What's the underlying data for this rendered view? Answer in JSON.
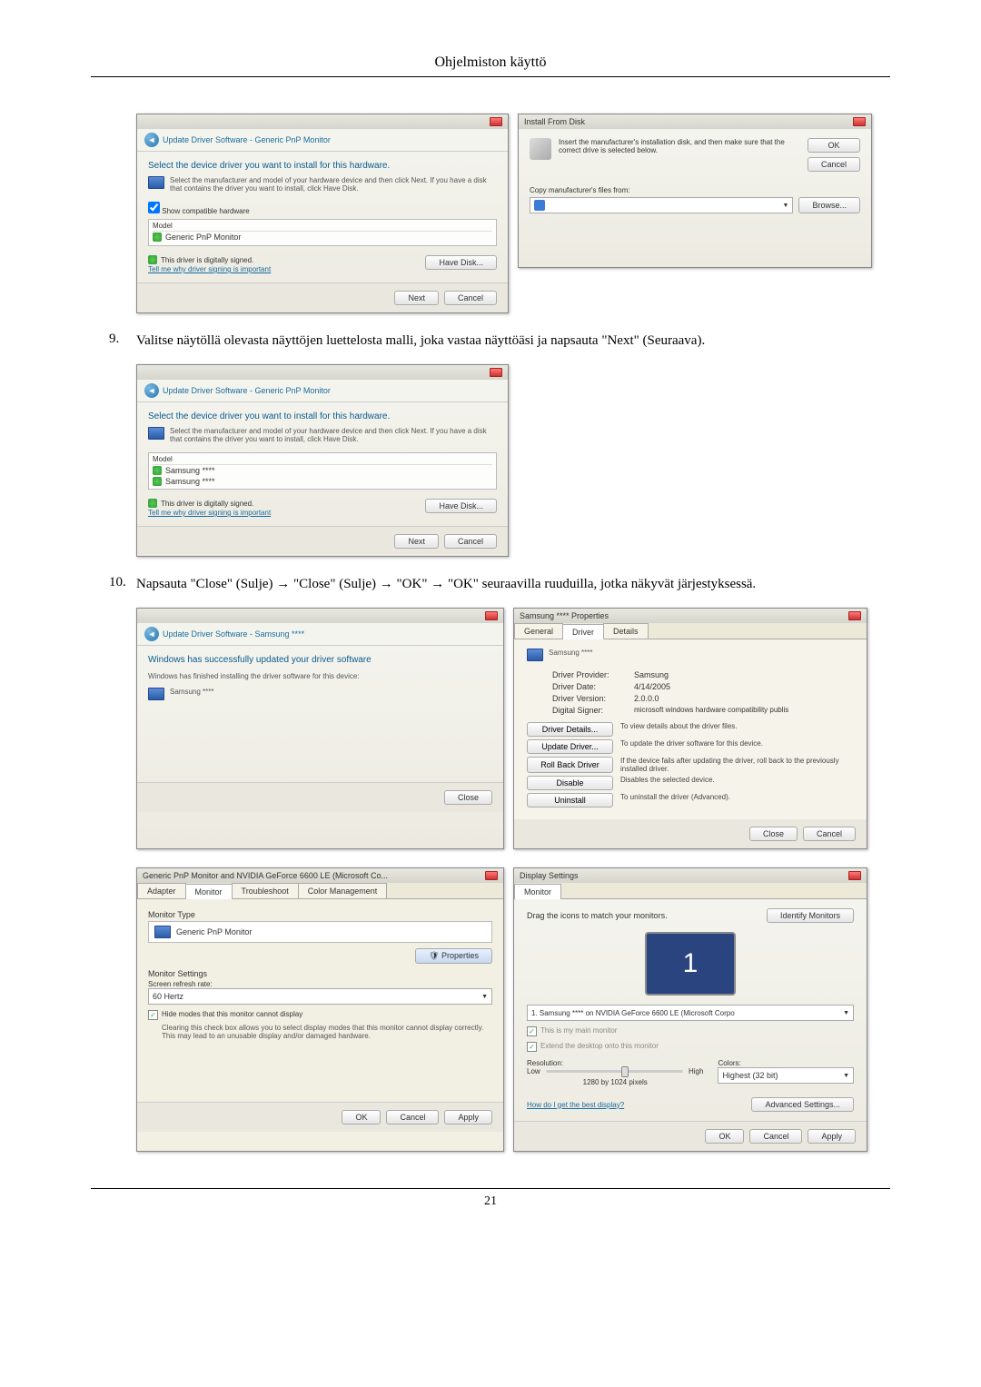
{
  "page": {
    "header": "Ohjelmiston käyttö",
    "number": "21"
  },
  "steps": {
    "s9": {
      "num": "9.",
      "text": "Valitse näytöllä olevasta näyttöjen luettelosta malli, joka vastaa näyttöäsi ja napsauta \"Next\" (Seuraava)."
    },
    "s10": {
      "num": "10.",
      "text": "Napsauta \"Close\" (Sulje) → \"Close\" (Sulje) → \"OK\" → \"OK\" seuraavilla ruuduilla, jotka näkyvät järjestyksessä."
    }
  },
  "dlg_update1": {
    "breadcrumb": "Update Driver Software - Generic PnP Monitor",
    "heading": "Select the device driver you want to install for this hardware.",
    "info": "Select the manufacturer and model of your hardware device and then click Next. If you have a disk that contains the driver you want to install, click Have Disk.",
    "show_compatible": "Show compatible hardware",
    "model_hdr": "Model",
    "model_item": "Generic PnP Monitor",
    "signed": "This driver is digitally signed.",
    "tell_me": "Tell me why driver signing is important",
    "have_disk": "Have Disk...",
    "next": "Next",
    "cancel": "Cancel"
  },
  "dlg_install_disk": {
    "title": "Install From Disk",
    "info": "Insert the manufacturer's installation disk, and then make sure that the correct drive is selected below.",
    "ok": "OK",
    "cancel": "Cancel",
    "copy_from": "Copy manufacturer's files from:",
    "browse": "Browse..."
  },
  "dlg_update2": {
    "breadcrumb": "Update Driver Software - Generic PnP Monitor",
    "heading": "Select the device driver you want to install for this hardware.",
    "info": "Select the manufacturer and model of your hardware device and then click Next. If you have a disk that contains the driver you want to install, click Have Disk.",
    "model_hdr": "Model",
    "model1": "Samsung ****",
    "model2": "Samsung ****",
    "signed": "This driver is digitally signed.",
    "tell_me": "Tell me why driver signing is important",
    "have_disk": "Have Disk...",
    "next": "Next",
    "cancel": "Cancel"
  },
  "dlg_update3": {
    "breadcrumb": "Update Driver Software - Samsung ****",
    "heading": "Windows has successfully updated your driver software",
    "info": "Windows has finished installing the driver software for this device:",
    "device": "Samsung ****",
    "close": "Close"
  },
  "dlg_props": {
    "title": "Samsung **** Properties",
    "tabs": {
      "general": "General",
      "driver": "Driver",
      "details": "Details"
    },
    "device": "Samsung ****",
    "provider_lbl": "Driver Provider:",
    "provider": "Samsung",
    "date_lbl": "Driver Date:",
    "date": "4/14/2005",
    "version_lbl": "Driver Version:",
    "version": "2.0.0.0",
    "signer_lbl": "Digital Signer:",
    "signer": "microsoft windows hardware compatibility publis",
    "btn_details": "Driver Details...",
    "desc_details": "To view details about the driver files.",
    "btn_update": "Update Driver...",
    "desc_update": "To update the driver software for this device.",
    "btn_rollback": "Roll Back Driver",
    "desc_rollback": "If the device fails after updating the driver, roll back to the previously installed driver.",
    "btn_disable": "Disable",
    "desc_disable": "Disables the selected device.",
    "btn_uninstall": "Uninstall",
    "desc_uninstall": "To uninstall the driver (Advanced).",
    "close": "Close",
    "cancel": "Cancel"
  },
  "dlg_monset": {
    "title": "Generic PnP Monitor and NVIDIA GeForce 6600 LE (Microsoft Co...",
    "tabs": {
      "adapter": "Adapter",
      "monitor": "Monitor",
      "troubleshoot": "Troubleshoot",
      "color": "Color Management"
    },
    "type_lbl": "Monitor Type",
    "type_val": "Generic PnP Monitor",
    "properties": "Properties",
    "settings_lbl": "Monitor Settings",
    "refresh_lbl": "Screen refresh rate:",
    "refresh_val": "60 Hertz",
    "hide_check": "Hide modes that this monitor cannot display",
    "hide_note": "Clearing this check box allows you to select display modes that this monitor cannot display correctly. This may lead to an unusable display and/or damaged hardware.",
    "ok": "OK",
    "cancel": "Cancel",
    "apply": "Apply"
  },
  "dlg_display": {
    "title": "Display Settings",
    "tab": "Monitor",
    "drag": "Drag the icons to match your monitors.",
    "identify": "Identify Monitors",
    "mon_num": "1",
    "monitor_list": "1. Samsung **** on NVIDIA GeForce 6600 LE (Microsoft Corpo",
    "main": "This is my main monitor",
    "extend": "Extend the desktop onto this monitor",
    "res_lbl": "Resolution:",
    "low": "Low",
    "high": "High",
    "res_val": "1280 by 1024 pixels",
    "colors_lbl": "Colors:",
    "colors_val": "Highest (32 bit)",
    "best": "How do I get the best display?",
    "advanced": "Advanced Settings...",
    "ok": "OK",
    "cancel": "Cancel",
    "apply": "Apply"
  }
}
